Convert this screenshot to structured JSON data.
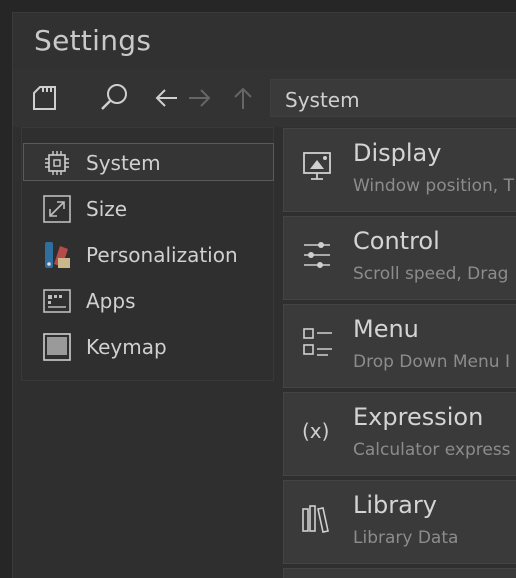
{
  "window": {
    "title": "Settings"
  },
  "toolbar": {
    "path": "System",
    "icons": [
      "sd-card-icon",
      "search-icon",
      "back-arrow-icon",
      "forward-arrow-icon",
      "up-arrow-icon"
    ]
  },
  "sidebar": {
    "items": [
      {
        "label": "System",
        "icon": "chip-icon",
        "selected": true
      },
      {
        "label": "Size",
        "icon": "resize-icon"
      },
      {
        "label": "Personalization",
        "icon": "palette-icon"
      },
      {
        "label": "Apps",
        "icon": "apps-icon"
      },
      {
        "label": "Keymap",
        "icon": "keymap-icon"
      }
    ]
  },
  "main": {
    "cards": [
      {
        "title": "Display",
        "subtitle": "Window position, T",
        "icon": "display-icon"
      },
      {
        "title": "Control",
        "subtitle": "Scroll speed, Drag",
        "icon": "sliders-icon"
      },
      {
        "title": "Menu",
        "subtitle": "Drop Down Menu I",
        "icon": "menu-icon"
      },
      {
        "title": "Expression",
        "subtitle": "Calculator express",
        "icon": "expression-icon"
      },
      {
        "title": "Library",
        "subtitle": "Library Data",
        "icon": "library-icon"
      }
    ]
  },
  "colors": {
    "background": "#262626",
    "panel": "#2f2f2f",
    "card": "#3a3a3a",
    "text": "#d0d0d0",
    "muted": "#8c8c8c"
  }
}
